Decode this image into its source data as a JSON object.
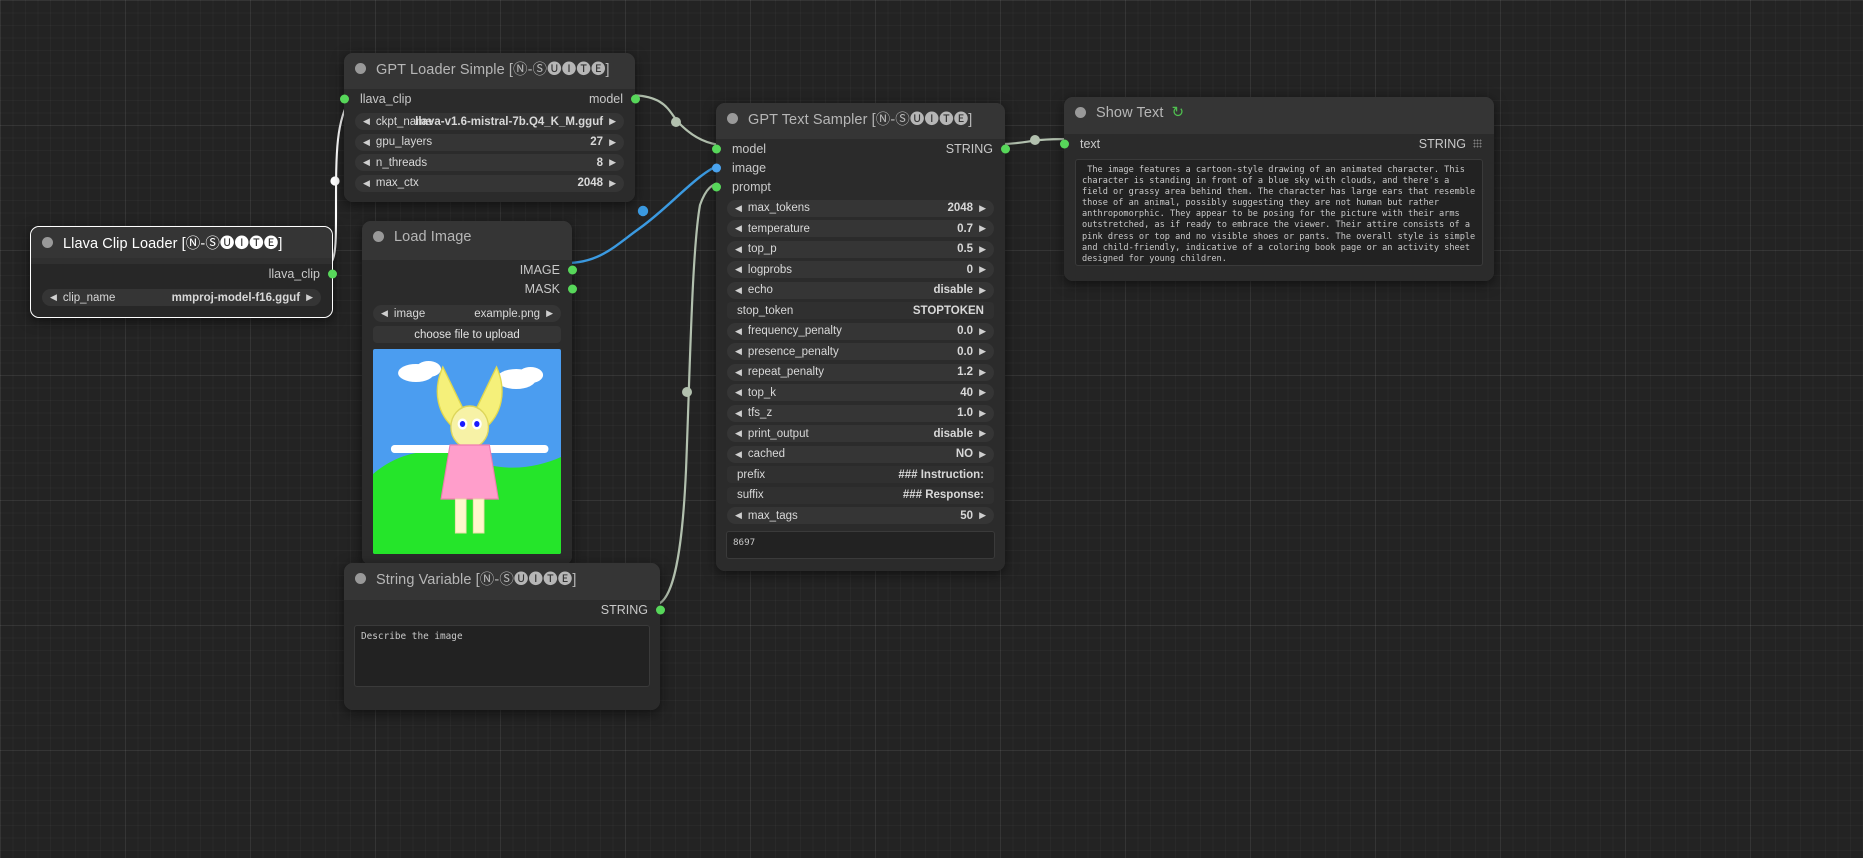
{
  "suffix": "[Ⓝ-Ⓢ🅤🅘🅣🅔]",
  "nodes": {
    "llava_clip_loader": {
      "title": "Llava Clip Loader [Ⓝ-Ⓢ🅤🅘🅣🅔]",
      "output_slot": "llava_clip",
      "widgets": [
        {
          "name": "clip_name",
          "value": "mmproj-model-f16.gguf"
        }
      ]
    },
    "gpt_loader_simple": {
      "title": "GPT Loader Simple [Ⓝ-Ⓢ🅤🅘🅣🅔]",
      "input_slot": "llava_clip",
      "output_slot": "model",
      "widgets": [
        {
          "name": "ckpt_name",
          "value": "llava-v1.6-mistral-7b.Q4_K_M.gguf"
        },
        {
          "name": "gpu_layers",
          "value": "27"
        },
        {
          "name": "n_threads",
          "value": "8"
        },
        {
          "name": "max_ctx",
          "value": "2048"
        }
      ]
    },
    "load_image": {
      "title": "Load Image",
      "outputs": [
        "IMAGE",
        "MASK"
      ],
      "widgets": [
        {
          "name": "image",
          "value": "example.png"
        }
      ],
      "upload_button": "choose file to upload"
    },
    "string_variable": {
      "title": "String Variable [Ⓝ-Ⓢ🅤🅘🅣🅔]",
      "output_slot": "STRING",
      "text": "Describe the image"
    },
    "gpt_text_sampler": {
      "title": "GPT Text Sampler [Ⓝ-Ⓢ🅤🅘🅣🅔]",
      "inputs": [
        "model",
        "image",
        "prompt"
      ],
      "output_slot": "STRING",
      "widgets": [
        {
          "name": "max_tokens",
          "value": "2048",
          "type": "stepper"
        },
        {
          "name": "temperature",
          "value": "0.7",
          "type": "stepper"
        },
        {
          "name": "top_p",
          "value": "0.5",
          "type": "stepper"
        },
        {
          "name": "logprobs",
          "value": "0",
          "type": "stepper"
        },
        {
          "name": "echo",
          "value": "disable",
          "type": "stepper"
        },
        {
          "name": "stop_token",
          "value": "STOPTOKEN",
          "type": "text"
        },
        {
          "name": "frequency_penalty",
          "value": "0.0",
          "type": "stepper"
        },
        {
          "name": "presence_penalty",
          "value": "0.0",
          "type": "stepper"
        },
        {
          "name": "repeat_penalty",
          "value": "1.2",
          "type": "stepper"
        },
        {
          "name": "top_k",
          "value": "40",
          "type": "stepper"
        },
        {
          "name": "tfs_z",
          "value": "1.0",
          "type": "stepper"
        },
        {
          "name": "print_output",
          "value": "disable",
          "type": "stepper"
        },
        {
          "name": "cached",
          "value": "NO",
          "type": "stepper"
        },
        {
          "name": "prefix",
          "value": "### Instruction:",
          "type": "text"
        },
        {
          "name": "suffix",
          "value": "### Response:",
          "type": "text"
        },
        {
          "name": "max_tags",
          "value": "50",
          "type": "stepper"
        }
      ],
      "seed_box": "8697"
    },
    "show_text": {
      "title": "Show Text",
      "input_slot": "text",
      "type_label": "STRING",
      "text": " The image features a cartoon-style drawing of an animated character. This character is standing in front of a blue sky with clouds, and there's a field or grassy area behind them. The character has large ears that resemble those of an animal, possibly suggesting they are not human but rather anthropomorphic. They appear to be posing for the picture with their arms outstretched, as if ready to embrace the viewer. Their attire consists of a pink dress or top and no visible shoes or pants. The overall style is simple and child-friendly, indicative of a coloring book page or an activity sheet designed for young children."
    }
  },
  "colors": {
    "link_default": "#b2c0ae",
    "link_image": "#3b9ae1",
    "slot_green": "#57d75a",
    "slot_blue": "#4aa3ee",
    "node_bg": "#2b2b2b",
    "node_title_bg": "#353535"
  }
}
